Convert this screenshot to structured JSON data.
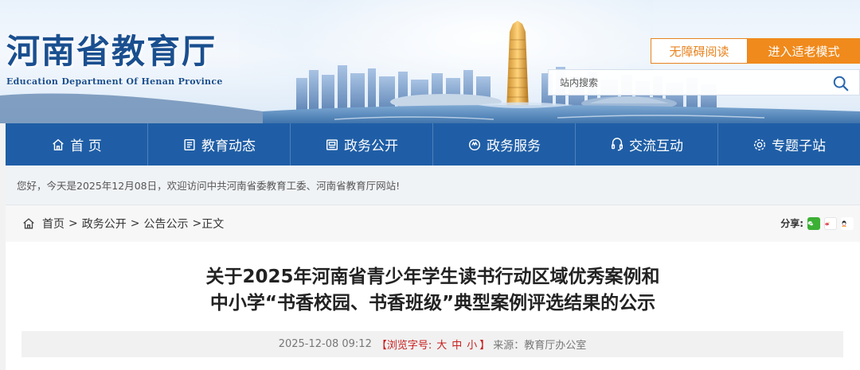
{
  "site": {
    "title_cn": "河南省教育厅",
    "title_en": "Education Department Of Henan Province"
  },
  "header": {
    "accessibility_label": "无障碍阅读",
    "elder_mode_label": "进入适老模式",
    "search_placeholder": "站内搜索",
    "accent_color": "#f08a1c"
  },
  "nav": {
    "items": [
      {
        "label": "首 页",
        "icon": "home-icon"
      },
      {
        "label": "教育动态",
        "icon": "news-icon"
      },
      {
        "label": "政务公开",
        "icon": "document-icon"
      },
      {
        "label": "政务服务",
        "icon": "service-icon"
      },
      {
        "label": "交流互动",
        "icon": "chat-icon"
      },
      {
        "label": "专题子站",
        "icon": "topic-icon"
      }
    ],
    "background": "#1f5ea6"
  },
  "welcome": {
    "text": "您好，今天是2025年12月08日，欢迎访问中共河南省委教育工委、河南省教育厅网站!"
  },
  "breadcrumb": {
    "items": [
      "首页",
      "政务公开",
      "公告公示"
    ],
    "current": "正文",
    "separator": ">"
  },
  "share": {
    "label": "分享:",
    "icons": [
      "wechat-icon",
      "weibo-icon",
      "qq-icon"
    ]
  },
  "article": {
    "title_line1": "关于2025年河南省青少年学生读书行动区域优秀案例和",
    "title_line2": "中小学“书香校园、书香班级”典型案例评选结果的公示",
    "date": "2025-12-08 09:12",
    "font_size_label": "【浏览字号:",
    "font_size_large": "大",
    "font_size_medium": "中",
    "font_size_small": "小",
    "font_size_close": "】",
    "source": "来源：教育厅办公室"
  }
}
